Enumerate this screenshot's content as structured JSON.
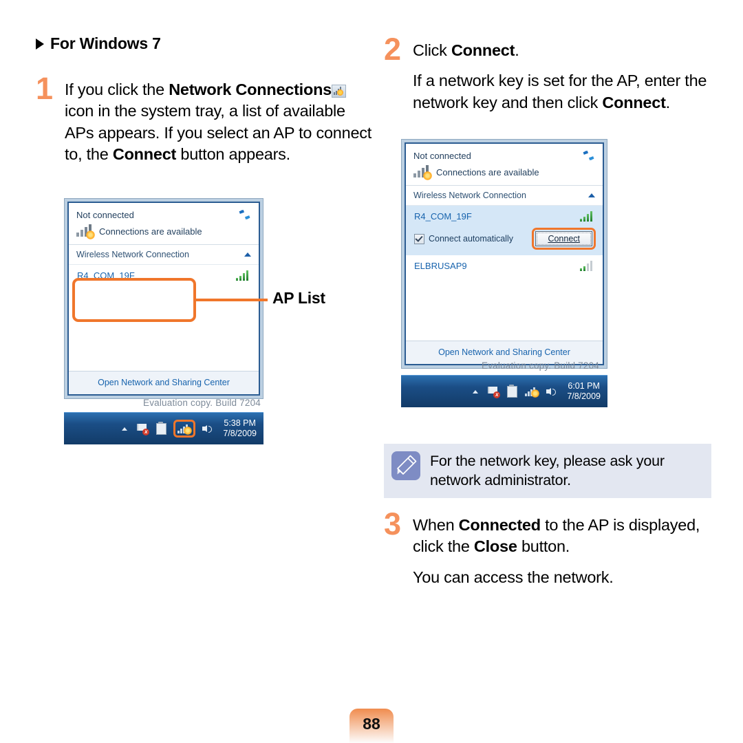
{
  "page": {
    "number": "88"
  },
  "left_column": {
    "heading": "For Windows 7",
    "heading_icon": "triangle-right-icon",
    "step1": {
      "number": "1",
      "text_part1": "If you click the ",
      "bold1": "Network Connections",
      "icon": "network-tray-icon",
      "text_part2": " icon in the system tray, a list of available APs appears. If you select an AP to connect to, the ",
      "bold2": "Connect",
      "text_part3": " button appears."
    },
    "callout": {
      "label": "AP List"
    }
  },
  "right_column": {
    "step2": {
      "number": "2",
      "line1_part1": "Click ",
      "line1_bold": "Connect",
      "line1_part2": ".",
      "line2_part1": "If a network key is set for the AP, enter the network key and then click ",
      "line2_bold": "Connect",
      "line2_part2": "."
    },
    "note": {
      "icon": "pencil-note-icon",
      "text": "For the network key, please ask your network administrator."
    },
    "step3": {
      "number": "3",
      "line1_part1": "When ",
      "line1_bold1": "Connected",
      "line1_part2": " to the AP is displayed, click the ",
      "line1_bold2": "Close",
      "line1_part3": " button.",
      "line2": "You can access the network."
    }
  },
  "flyout1": {
    "status": "Not connected",
    "availability": "Connections are available",
    "availability_icon": "network-bars-alert-icon",
    "refresh_icon": "refresh-icon",
    "section_label": "Wireless Network Connection",
    "collapse_icon": "chevron-up-icon",
    "networks": [
      {
        "ssid": "R4_COM_19F",
        "signal_icon": "signal-full-icon",
        "selected": false
      }
    ],
    "footer_link": "Open Network and Sharing Center",
    "watermark": "Evaluation copy. Build 7204"
  },
  "taskbar1": {
    "overflow_icon": "chevron-up-icon",
    "tray_icons": [
      "flag-alert-icon",
      "action-center-icon",
      "network-tray-icon",
      "volume-icon"
    ],
    "time": "5:38 PM",
    "date": "7/8/2009"
  },
  "flyout2": {
    "status": "Not connected",
    "availability": "Connections are available",
    "availability_icon": "network-bars-alert-icon",
    "refresh_icon": "refresh-icon",
    "section_label": "Wireless Network Connection",
    "collapse_icon": "chevron-up-icon",
    "networks": [
      {
        "ssid": "R4_COM_19F",
        "signal_icon": "signal-full-icon",
        "selected": true
      },
      {
        "ssid": "ELBRUSAP9",
        "signal_icon": "signal-weak-icon",
        "selected": false
      }
    ],
    "connect_automatically_label": "Connect automatically",
    "connect_automatically_checked": true,
    "connect_button_label": "Connect",
    "footer_link": "Open Network and Sharing Center",
    "watermark": "Evaluation copy. Build 7204"
  },
  "taskbar2": {
    "overflow_icon": "chevron-up-icon",
    "tray_icons": [
      "flag-alert-icon",
      "action-center-icon",
      "network-tray-icon",
      "volume-icon"
    ],
    "time": "6:01 PM",
    "date": "7/8/2009"
  },
  "colors": {
    "accent_orange": "#F0762B",
    "step_number_orange": "#F5915C",
    "link_blue": "#1763ad",
    "note_bg": "#e3e7f1",
    "note_icon_bg": "#7e8cc4"
  }
}
